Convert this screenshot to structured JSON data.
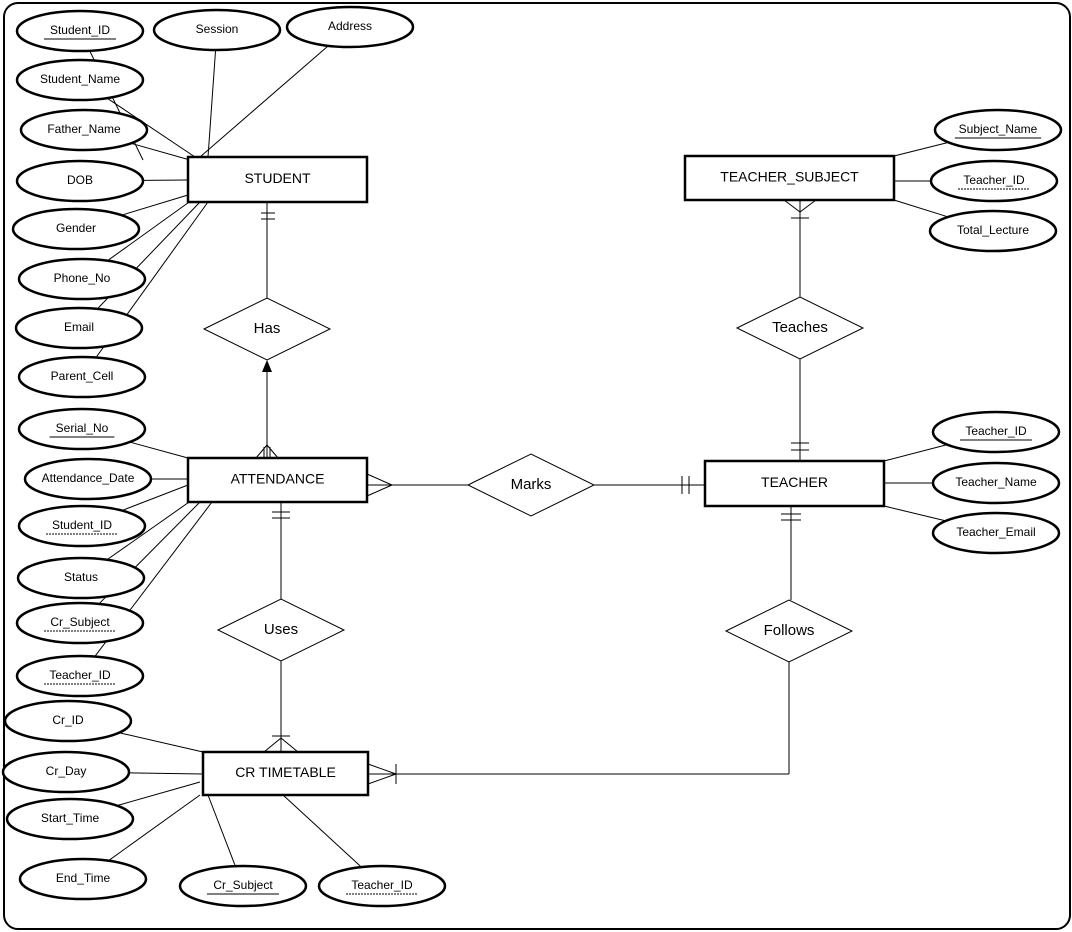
{
  "entities": {
    "student": {
      "label": "STUDENT",
      "attributes": [
        {
          "label": "Student_ID",
          "key": "primary"
        },
        {
          "label": "Session"
        },
        {
          "label": "Address"
        },
        {
          "label": "Student_Name"
        },
        {
          "label": "Father_Name"
        },
        {
          "label": "DOB"
        },
        {
          "label": "Gender"
        },
        {
          "label": "Phone_No"
        },
        {
          "label": "Email"
        },
        {
          "label": "Parent_Cell"
        }
      ]
    },
    "attendance": {
      "label": "ATTENDANCE",
      "attributes": [
        {
          "label": "Serial_No",
          "key": "primary"
        },
        {
          "label": "Attendance_Date"
        },
        {
          "label": "Student_ID",
          "key": "foreign"
        },
        {
          "label": "Status"
        },
        {
          "label": "Cr_Subject",
          "key": "foreign"
        },
        {
          "label": "Teacher_ID",
          "key": "foreign"
        }
      ]
    },
    "teacher": {
      "label": "TEACHER",
      "attributes": [
        {
          "label": "Teacher_ID",
          "key": "primary"
        },
        {
          "label": "Teacher_Name"
        },
        {
          "label": "Teacher_Email"
        }
      ]
    },
    "teacher_subject": {
      "label": "TEACHER_SUBJECT",
      "attributes": [
        {
          "label": "Subject_Name",
          "key": "primary"
        },
        {
          "label": "Teacher_ID",
          "key": "foreign"
        },
        {
          "label": "Total_Lecture"
        }
      ]
    },
    "cr_timetable": {
      "label": "CR  TIMETABLE",
      "attributes": [
        {
          "label": "Cr_ID"
        },
        {
          "label": "Cr_Day"
        },
        {
          "label": "Start_Time"
        },
        {
          "label": "End_Time"
        },
        {
          "label": "Cr_Subject",
          "key": "primary"
        },
        {
          "label": "Teacher_ID",
          "key": "foreign"
        }
      ]
    }
  },
  "relationships": {
    "has": "Has",
    "marks": "Marks",
    "teaches": "Teaches",
    "uses": "Uses",
    "follows": "Follows"
  }
}
